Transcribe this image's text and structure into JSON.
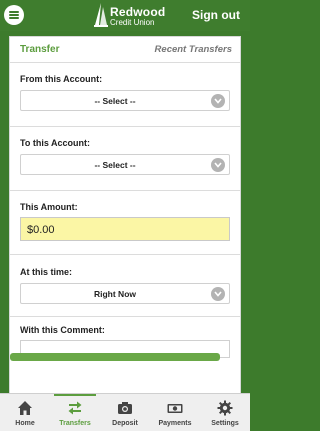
{
  "header": {
    "brand_line1": "Redwood",
    "brand_line2": "Credit Union",
    "signout_label": "Sign out"
  },
  "tabs": {
    "transfer": "Transfer",
    "recent": "Recent Transfers"
  },
  "form": {
    "from_label": "From this Account:",
    "from_value": "-- Select --",
    "to_label": "To this Account:",
    "to_value": "-- Select --",
    "amount_label": "This Amount:",
    "amount_value": "$0.00",
    "time_label": "At this time:",
    "time_value": "Right Now",
    "comment_label": "With this Comment:",
    "comment_value": ""
  },
  "nav": [
    {
      "label": "Home",
      "icon": "home-icon"
    },
    {
      "label": "Transfers",
      "icon": "transfers-icon",
      "active": true
    },
    {
      "label": "Deposit",
      "icon": "camera-icon"
    },
    {
      "label": "Payments",
      "icon": "payments-icon"
    },
    {
      "label": "Settings",
      "icon": "gear-icon"
    }
  ],
  "colors": {
    "brand_green": "#3f7d2e",
    "accent_green": "#5c9d3e",
    "amount_bg": "#fbf6a5"
  }
}
